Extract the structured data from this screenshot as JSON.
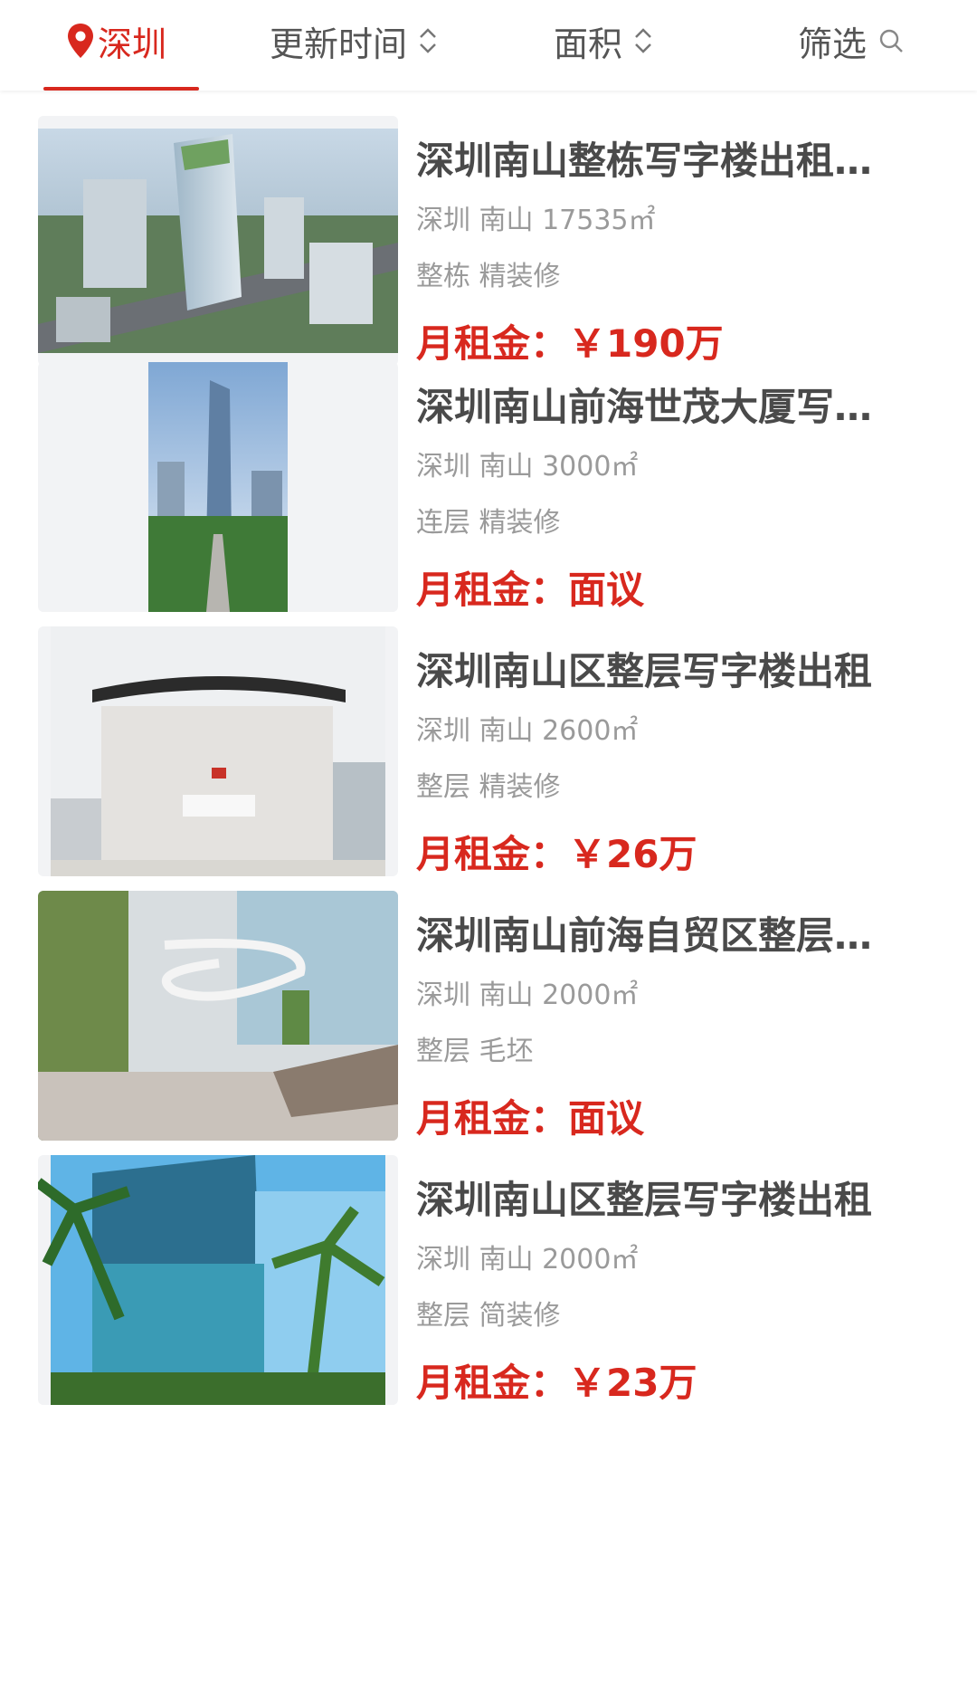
{
  "filters": {
    "city": "深圳",
    "update_time": "更新时间",
    "area": "面积",
    "filter": "筛选"
  },
  "colors": {
    "accent": "#d8281e",
    "title": "#4a4a4a",
    "meta": "#9a9a9a"
  },
  "listings": [
    {
      "title": "深圳南山整栋写字楼出租写字楼",
      "location": "深圳 南山 17535㎡",
      "tags": "整栋 精装修",
      "price_label": "月租金：",
      "price_value": "￥190万",
      "image": "aerial-skyscraper-rendering"
    },
    {
      "title": "深圳南山前海世茂大厦写字楼",
      "location": "深圳 南山 3000㎡",
      "tags": "连层 精装修",
      "price_label": "月租金：",
      "price_value": "面议",
      "image": "tower-street-view"
    },
    {
      "title": "深圳南山区整层写字楼出租",
      "location": "深圳 南山 2600㎡",
      "tags": "整层 精装修",
      "price_label": "月租金：",
      "price_value": "￥26万",
      "image": "white-lobby-reception"
    },
    {
      "title": "深圳南山前海自贸区整层写字楼",
      "location": "深圳 南山 2000㎡",
      "tags": "整层 毛坯",
      "price_label": "月租金：",
      "price_value": "面议",
      "image": "atrium-spiral-staircase"
    },
    {
      "title": "深圳南山区整层写字楼出租",
      "location": "深圳 南山 2000㎡",
      "tags": "整层 简装修",
      "price_label": "月租金：",
      "price_value": "￥23万",
      "image": "glass-building-palm-trees"
    }
  ]
}
